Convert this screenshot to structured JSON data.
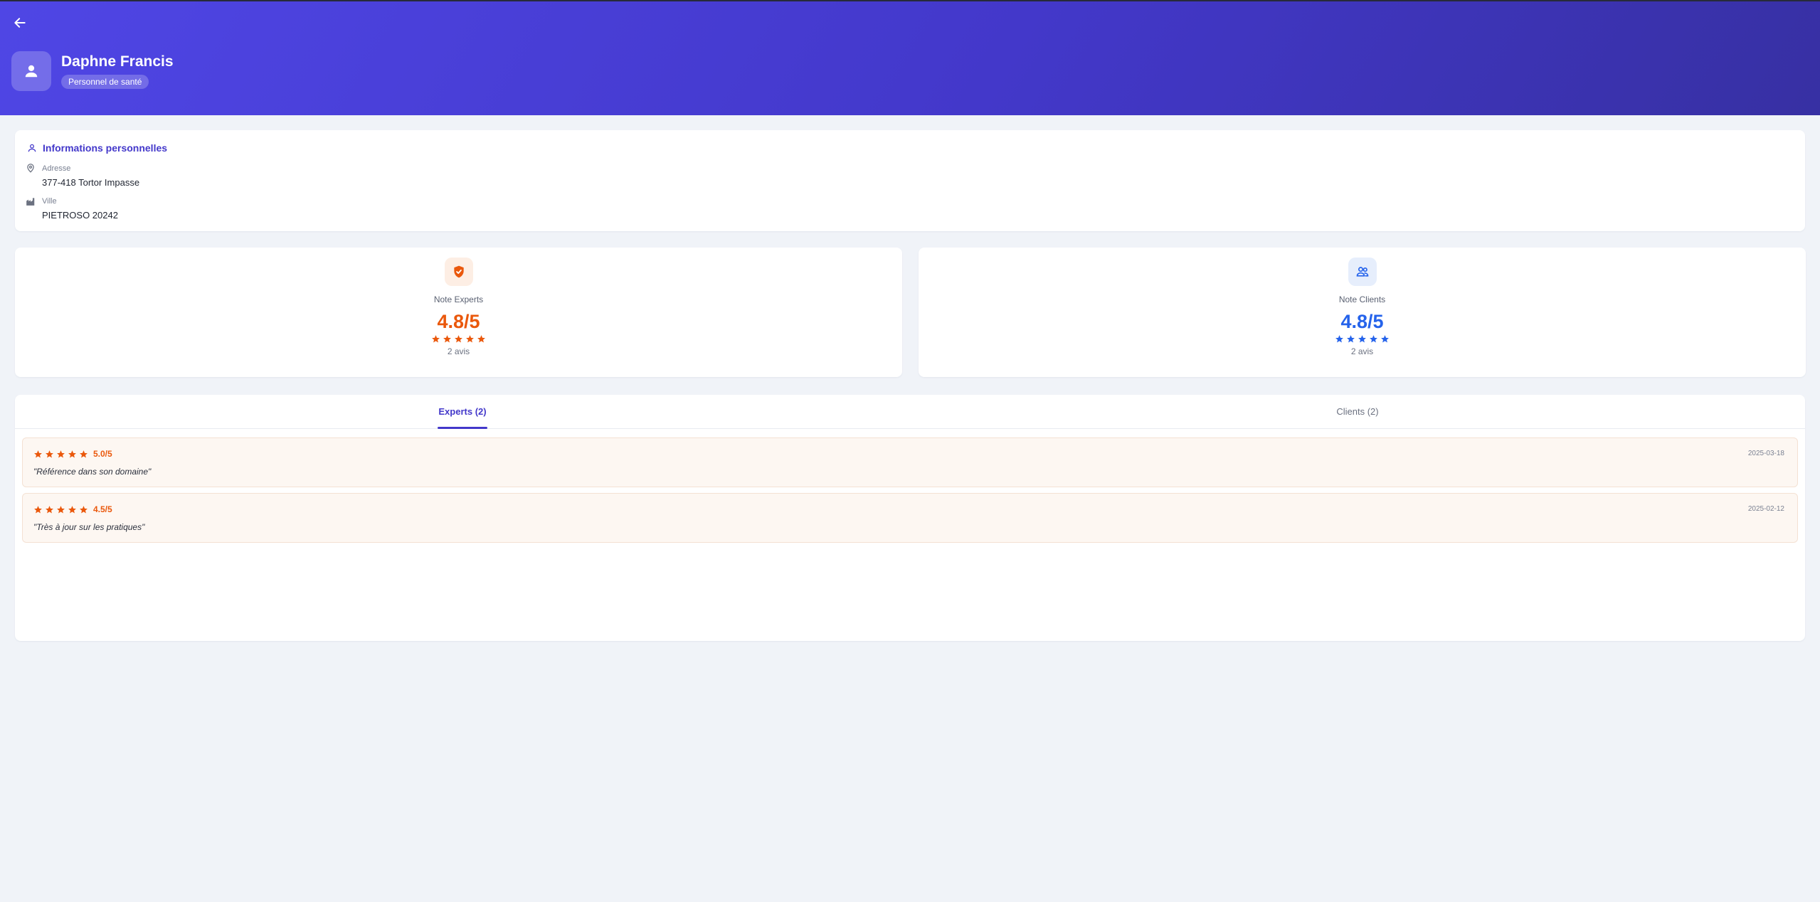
{
  "header": {
    "name": "Daphne Francis",
    "role": "Personnel de santé"
  },
  "personal_info": {
    "title": "Informations personnelles",
    "address_label": "Adresse",
    "address_value": "377-418 Tortor Impasse",
    "city_label": "Ville",
    "city_value": "PIETROSO 20242"
  },
  "ratings": {
    "experts": {
      "label": "Note Experts",
      "score": "4.8/5",
      "stars": 5,
      "count": "2 avis",
      "color": "#ea580c"
    },
    "clients": {
      "label": "Note Clients",
      "score": "4.8/5",
      "stars": 5,
      "count": "2 avis",
      "color": "#2563eb"
    }
  },
  "tabs": [
    {
      "label": "Experts (2)",
      "active": true
    },
    {
      "label": "Clients (2)",
      "active": false
    }
  ],
  "reviews": [
    {
      "score": "5.0/5",
      "stars": 5,
      "date": "2025-03-18",
      "text": "\"Référence dans son domaine\""
    },
    {
      "score": "4.5/5",
      "stars": 5,
      "date": "2025-02-12",
      "text": "\"Très à jour sur les pratiques\""
    }
  ],
  "colors": {
    "accent": "#4338ca",
    "header_start": "#4f46e5",
    "header_end": "#3730a3",
    "experts": "#ea580c",
    "clients": "#2563eb"
  }
}
